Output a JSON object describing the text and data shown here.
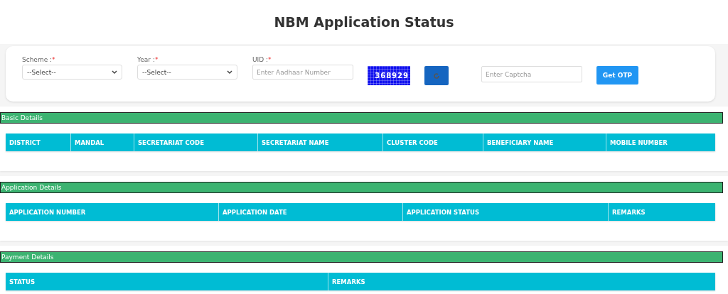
{
  "title": "NBM Application Status",
  "form": {
    "fields": [
      {
        "kind": "select",
        "label": "Scheme :",
        "required_mark": "*",
        "value": "--Select--"
      },
      {
        "kind": "select",
        "label": "Year :",
        "required_mark": "*",
        "value": "--Select--"
      },
      {
        "kind": "input",
        "label": "UID :",
        "required_mark": "*",
        "placeholder": "Enter Aadhaar Number"
      }
    ],
    "captcha": "368929",
    "captcha_placeholder": "Enter Captcha",
    "button": "Get OTP"
  },
  "sections": [
    {
      "title": "Basic Details",
      "columns": [
        "DISTRICT",
        "MANDAL",
        "SECRETARIAT CODE",
        "SECRETARIAT NAME",
        "CLUSTER CODE",
        "BENEFICIARY NAME",
        "MOBILE NUMBER"
      ]
    },
    {
      "title": "Application Details",
      "columns": [
        "APPLICATION NUMBER",
        "APPLICATION DATE",
        "APPLICATION STATUS",
        "REMARKS"
      ]
    },
    {
      "title": "Payment Details",
      "columns": [
        "STATUS",
        "REMARKS"
      ]
    }
  ]
}
